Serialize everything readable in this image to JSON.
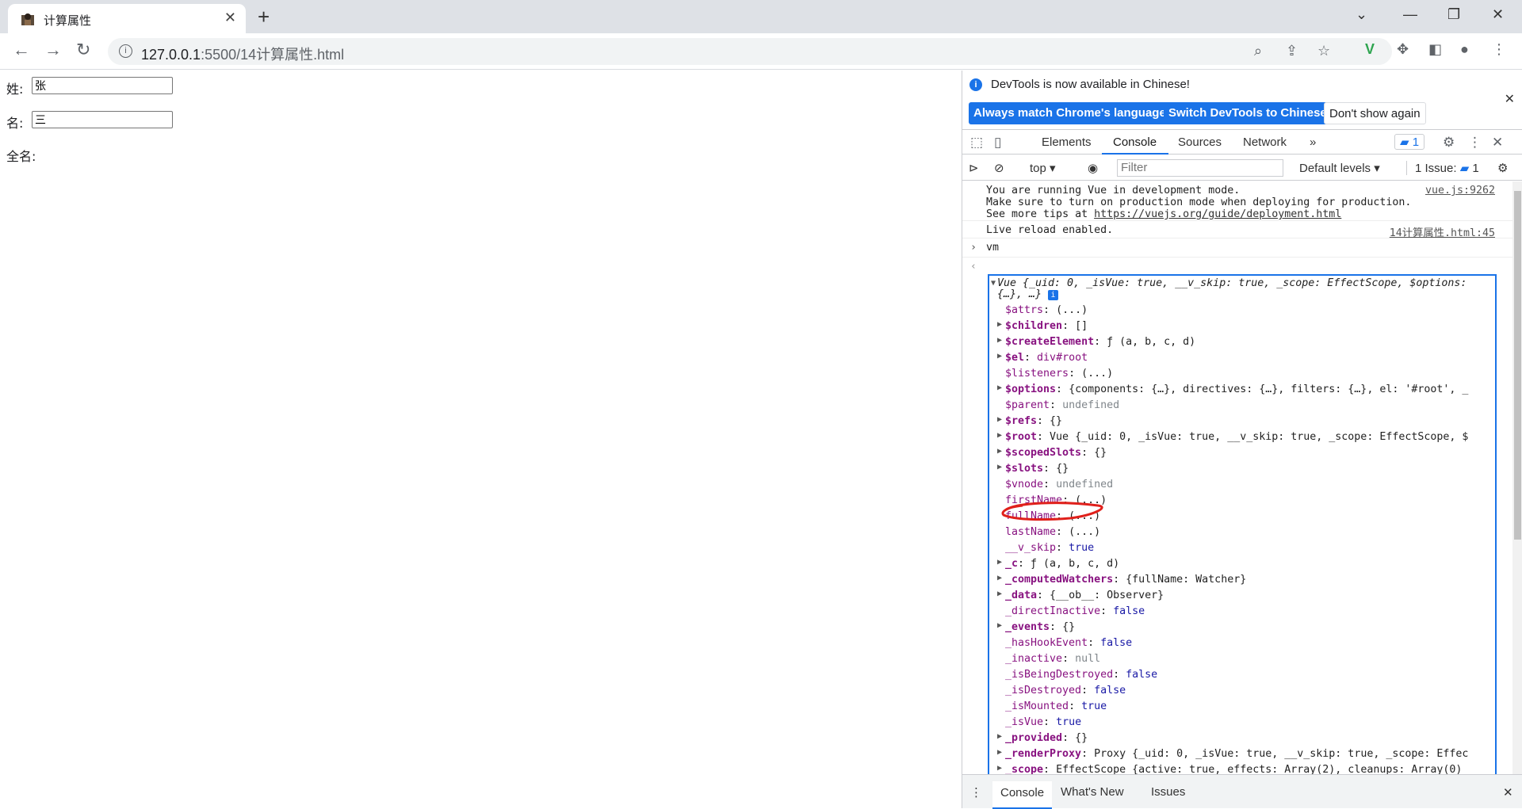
{
  "browser": {
    "tab_title": "计算属性",
    "url_host": "127.0.0.1",
    "url_path": ":5500/14计算属性.html"
  },
  "page": {
    "surname_label": "姓:",
    "surname_value": "张",
    "given_label": "名:",
    "given_value": "三",
    "fullname_label": "全名:"
  },
  "devtools": {
    "notice_text": "DevTools is now available in Chinese!",
    "btn_match": "Always match Chrome's language",
    "btn_switch": "Switch DevTools to Chinese",
    "btn_dont_show": "Don't show again",
    "tabs": [
      "Elements",
      "Console",
      "Sources",
      "Network"
    ],
    "issues_badge": "1",
    "context": "top",
    "filter_placeholder": "Filter",
    "levels": "Default levels",
    "issue_count": "1 Issue:",
    "issue_num": "1",
    "drawer_tabs": [
      "Console",
      "What's New",
      "Issues"
    ]
  },
  "console": {
    "dev_msg_1": "You are running Vue in development mode.",
    "dev_msg_2": "Make sure to turn on production mode when deploying for production.",
    "dev_msg_3a": "See more tips at ",
    "dev_msg_3b": "https://vuejs.org/guide/deployment.html",
    "dev_src": "vue.js:9262",
    "reload_msg": "Live reload enabled.",
    "reload_src": "14计算属性.html:45",
    "input_cmd": "vm",
    "obj_header": "Vue {_uid: 0, _isVue: true, __v_skip: true, _scope: EffectScope, $options:",
    "obj_header2": "{…}, …}",
    "props": [
      {
        "key": "$attrs",
        "val": "(...)",
        "arrow": false,
        "cls": "v-obj"
      },
      {
        "key": "$children",
        "val": "[]",
        "arrow": true,
        "cls": "v-obj"
      },
      {
        "key": "$createElement",
        "val": "ƒ (a, b, c, d)",
        "arrow": true,
        "cls": "v-obj"
      },
      {
        "key": "$el",
        "val": "div#root",
        "arrow": true,
        "cls": "v-kn"
      },
      {
        "key": "$listeners",
        "val": "(...)",
        "arrow": false,
        "cls": "v-obj"
      },
      {
        "key": "$options",
        "val": "{components: {…}, directives: {…}, filters: {…}, el: '#root', _",
        "arrow": true,
        "cls": "v-obj"
      },
      {
        "key": "$parent",
        "val": "undefined",
        "arrow": false,
        "cls": "v-undef"
      },
      {
        "key": "$refs",
        "val": "{}",
        "arrow": true,
        "cls": "v-obj"
      },
      {
        "key": "$root",
        "val": "Vue {_uid: 0, _isVue: true, __v_skip: true, _scope: EffectScope, $",
        "arrow": true,
        "cls": "v-obj"
      },
      {
        "key": "$scopedSlots",
        "val": "{}",
        "arrow": true,
        "cls": "v-obj"
      },
      {
        "key": "$slots",
        "val": "{}",
        "arrow": true,
        "cls": "v-obj"
      },
      {
        "key": "$vnode",
        "val": "undefined",
        "arrow": false,
        "cls": "v-undef"
      },
      {
        "key": "firstName",
        "val": "(...)",
        "arrow": false,
        "cls": "v-obj"
      },
      {
        "key": "fullName",
        "val": "(...)",
        "arrow": false,
        "cls": "v-obj"
      },
      {
        "key": "lastName",
        "val": "(...)",
        "arrow": false,
        "cls": "v-obj"
      },
      {
        "key": "__v_skip",
        "val": "true",
        "arrow": false,
        "cls": "v-bool"
      },
      {
        "key": "_c",
        "val": "ƒ (a, b, c, d)",
        "arrow": true,
        "cls": "v-obj"
      },
      {
        "key": "_computedWatchers",
        "val": "{fullName: Watcher}",
        "arrow": true,
        "cls": "v-obj"
      },
      {
        "key": "_data",
        "val": "{__ob__: Observer}",
        "arrow": true,
        "cls": "v-obj"
      },
      {
        "key": "_directInactive",
        "val": "false",
        "arrow": false,
        "cls": "v-bool"
      },
      {
        "key": "_events",
        "val": "{}",
        "arrow": true,
        "cls": "v-obj"
      },
      {
        "key": "_hasHookEvent",
        "val": "false",
        "arrow": false,
        "cls": "v-bool"
      },
      {
        "key": "_inactive",
        "val": "null",
        "arrow": false,
        "cls": "v-undef"
      },
      {
        "key": "_isBeingDestroyed",
        "val": "false",
        "arrow": false,
        "cls": "v-bool"
      },
      {
        "key": "_isDestroyed",
        "val": "false",
        "arrow": false,
        "cls": "v-bool"
      },
      {
        "key": "_isMounted",
        "val": "true",
        "arrow": false,
        "cls": "v-bool"
      },
      {
        "key": "_isVue",
        "val": "true",
        "arrow": false,
        "cls": "v-bool"
      },
      {
        "key": "_provided",
        "val": "{}",
        "arrow": true,
        "cls": "v-obj"
      },
      {
        "key": "_renderProxy",
        "val": "Proxy {_uid: 0, _isVue: true, __v_skip: true, _scope: Effec",
        "arrow": true,
        "cls": "v-obj"
      },
      {
        "key": "_scope",
        "val": "EffectScope {active: true, effects: Array(2), cleanups: Array(0)",
        "arrow": true,
        "cls": "v-obj"
      }
    ]
  },
  "colors": {
    "accent": "#1a73e8",
    "annotation": "#e0201b"
  }
}
